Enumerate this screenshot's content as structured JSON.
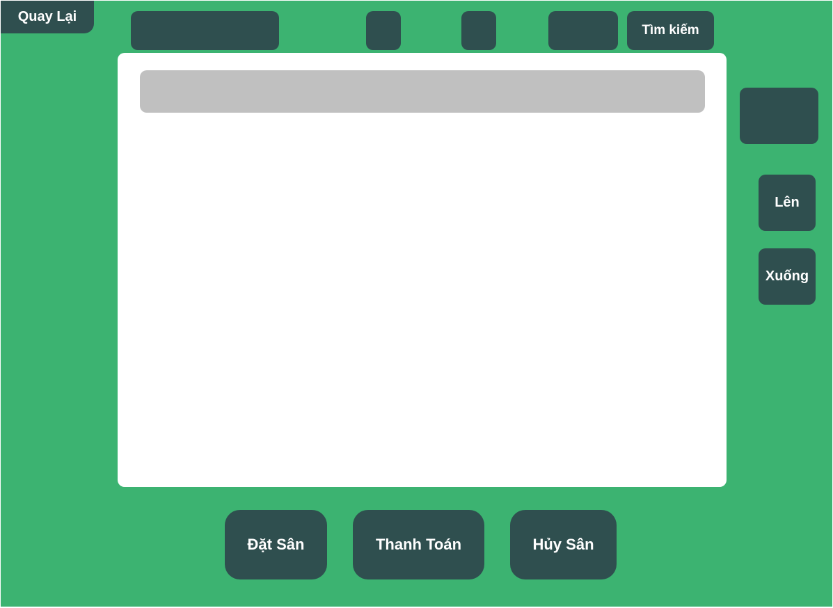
{
  "colors": {
    "background": "#3cb371",
    "button": "#2f4f4f",
    "panel": "#ffffff",
    "panel_header": "#c0c0c0",
    "text": "#ffffff"
  },
  "nav": {
    "back_label": "Quay Lại",
    "search_label": "Tìm kiếm"
  },
  "scroll": {
    "up_label": "Lên",
    "down_label": "Xuống"
  },
  "actions": {
    "book_label": "Đặt Sân",
    "pay_label": "Thanh Toán",
    "cancel_label": "Hủy Sân"
  }
}
